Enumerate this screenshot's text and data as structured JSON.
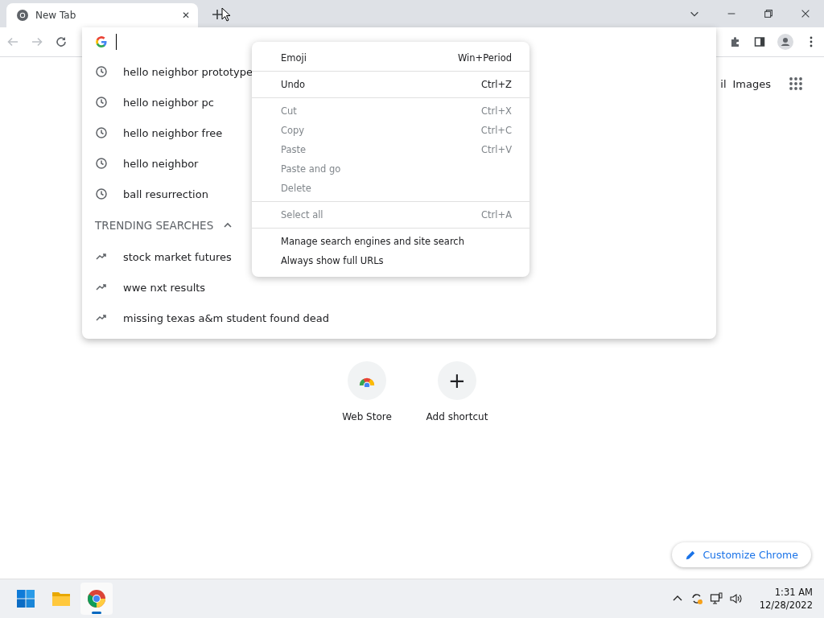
{
  "tab": {
    "title": "New Tab",
    "close": "✕"
  },
  "omnibox": {
    "suggestions": [
      {
        "kind": "history",
        "text": "hello neighbor prototype"
      },
      {
        "kind": "history",
        "text": "hello neighbor pc"
      },
      {
        "kind": "history",
        "text": "hello neighbor free"
      },
      {
        "kind": "history",
        "text": "hello neighbor"
      },
      {
        "kind": "history",
        "text": "ball resurrection"
      },
      {
        "kind": "header",
        "text": "TRENDING SEARCHES",
        "expanded": true
      },
      {
        "kind": "trending",
        "text": "stock market futures"
      },
      {
        "kind": "trending",
        "text": "wwe nxt results"
      },
      {
        "kind": "trending",
        "text": "missing texas a&m student found dead"
      }
    ]
  },
  "context_menu": [
    [
      {
        "label": "Emoji",
        "shortcut": "Win+Period",
        "disabled": false
      }
    ],
    [
      {
        "label": "Undo",
        "shortcut": "Ctrl+Z",
        "disabled": false
      }
    ],
    [
      {
        "label": "Cut",
        "shortcut": "Ctrl+X",
        "disabled": true
      },
      {
        "label": "Copy",
        "shortcut": "Ctrl+C",
        "disabled": true
      },
      {
        "label": "Paste",
        "shortcut": "Ctrl+V",
        "disabled": true
      },
      {
        "label": "Paste and go",
        "disabled": true
      },
      {
        "label": "Delete",
        "disabled": true
      }
    ],
    [
      {
        "label": "Select all",
        "shortcut": "Ctrl+A",
        "disabled": true
      }
    ],
    [
      {
        "label": "Manage search engines and site search",
        "disabled": false
      },
      {
        "label": "Always show full URLs",
        "disabled": false
      }
    ]
  ],
  "header_links": [
    "il",
    "Images"
  ],
  "shortcuts": [
    {
      "kind": "store",
      "label": "Web Store"
    },
    {
      "kind": "add",
      "label": "Add shortcut",
      "icon": "+"
    }
  ],
  "customize": {
    "label": "Customize Chrome"
  },
  "taskbar": {
    "apps": [
      {
        "kind": "start",
        "active": false
      },
      {
        "kind": "folder",
        "active": false
      },
      {
        "kind": "chrome",
        "active": true
      }
    ],
    "time": "1:31 AM",
    "date": "12/28/2022"
  }
}
